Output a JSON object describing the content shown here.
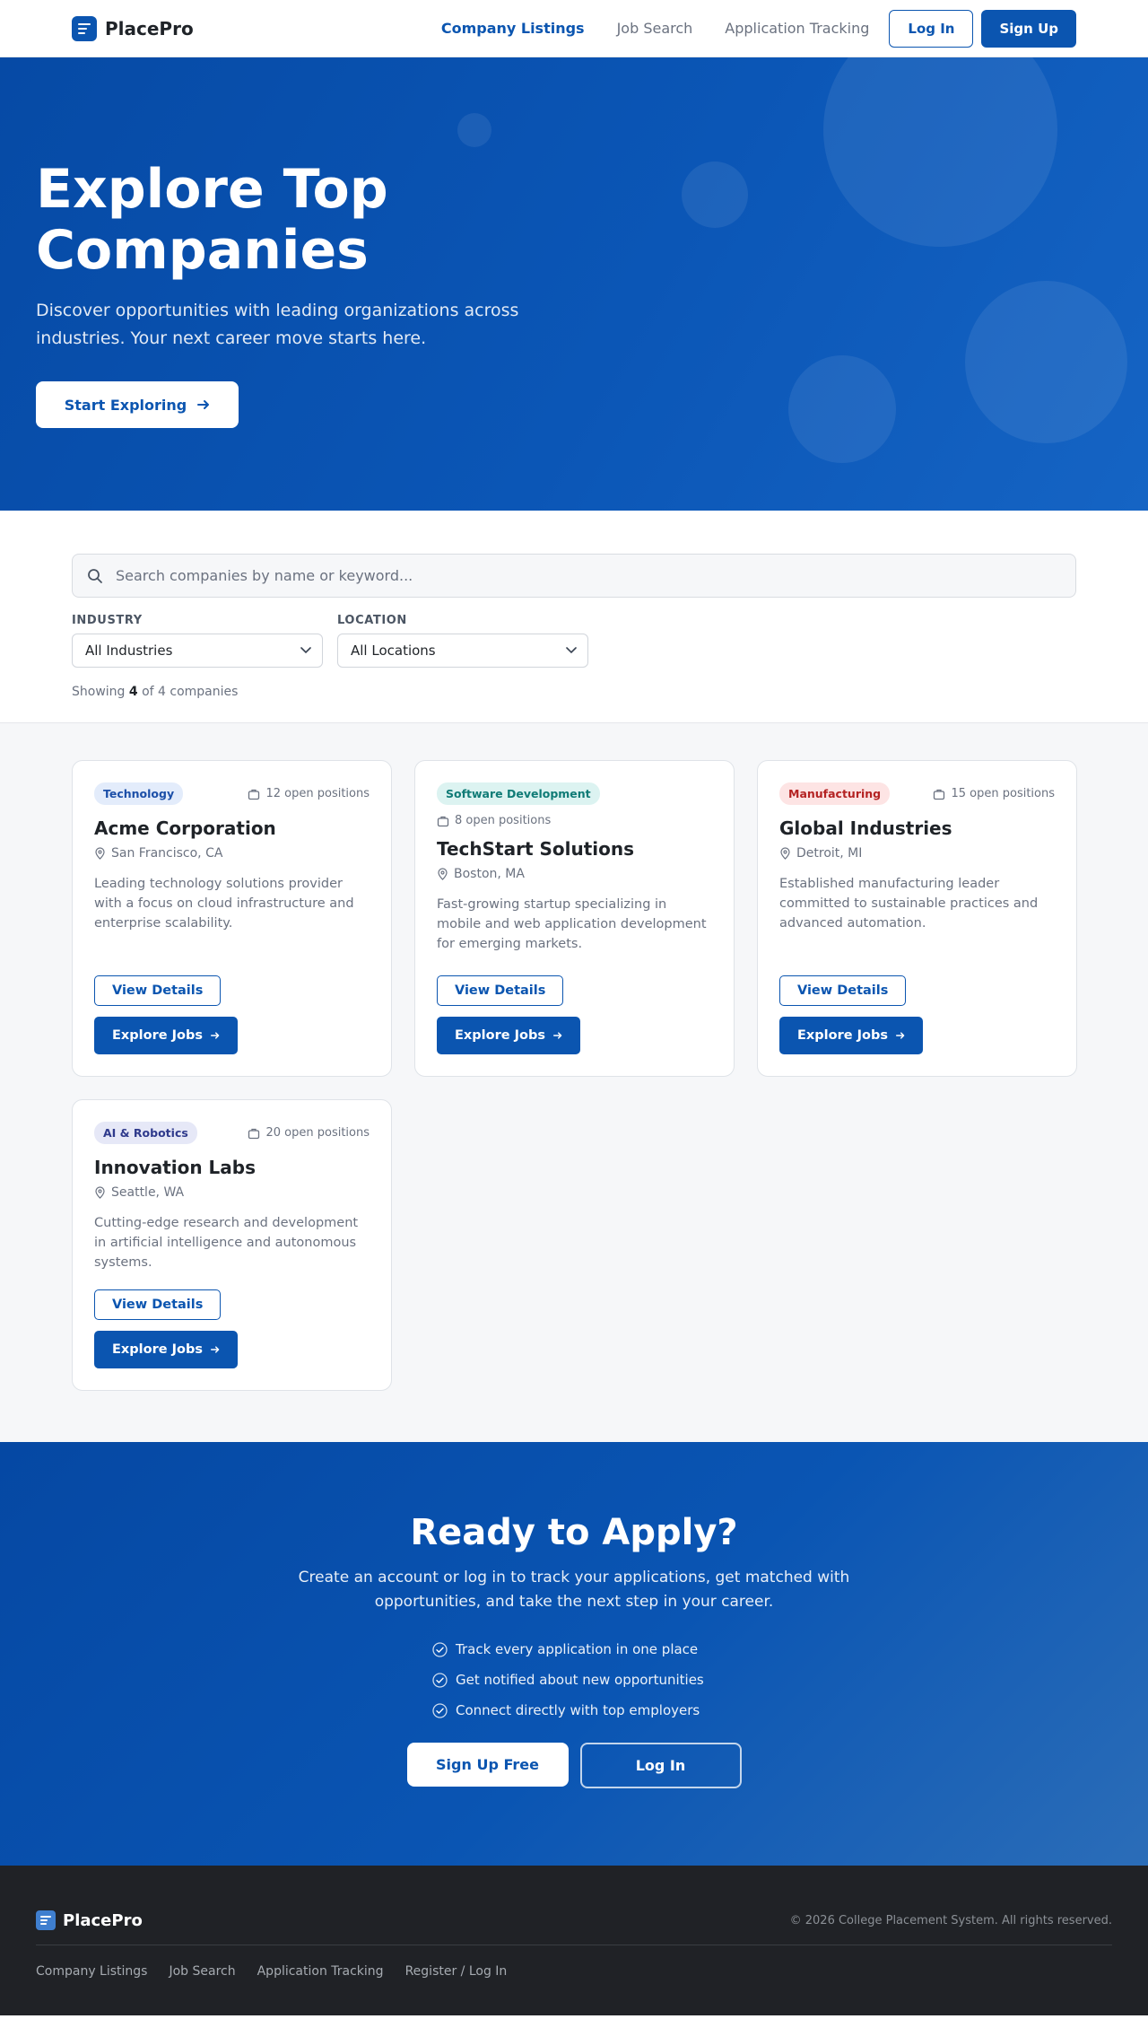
{
  "nav": {
    "brand": "PlacePro",
    "links": [
      "Company Listings",
      "Job Search",
      "Application Tracking"
    ],
    "login": "Log In",
    "signup": "Sign Up"
  },
  "hero": {
    "title_line1": "Explore Top",
    "title_line2": "Companies",
    "subtitle": "Discover opportunities with leading organizations across industries. Your next career move starts here.",
    "button": "Start Exploring"
  },
  "filters": {
    "search_placeholder": "Search companies by name or keyword...",
    "industry_label": "Industry",
    "industry_value": "All Industries",
    "location_label": "Location",
    "location_value": "All Locations",
    "showing_prefix": "Showing",
    "showing_count": "4",
    "showing_suffix": "of 4 companies"
  },
  "companies": [
    {
      "industry": "Technology",
      "positions": "12 open positions",
      "name": "Acme Corporation",
      "location": "San Francisco, CA",
      "description": "Leading technology solutions provider with a focus on cloud infrastructure and enterprise scalability.",
      "details_label": "View Details",
      "jobs_label": "Explore Jobs"
    },
    {
      "industry": "Software Development",
      "positions": "8 open positions",
      "name": "TechStart Solutions",
      "location": "Boston, MA",
      "description": "Fast-growing startup specializing in mobile and web application development for emerging markets.",
      "details_label": "View Details",
      "jobs_label": "Explore Jobs"
    },
    {
      "industry": "Manufacturing",
      "positions": "15 open positions",
      "name": "Global Industries",
      "location": "Detroit, MI",
      "description": "Established manufacturing leader committed to sustainable practices and advanced automation.",
      "details_label": "View Details",
      "jobs_label": "Explore Jobs"
    },
    {
      "industry": "AI & Robotics",
      "positions": "20 open positions",
      "name": "Innovation Labs",
      "location": "Seattle, WA",
      "description": "Cutting-edge research and development in artificial intelligence and autonomous systems.",
      "details_label": "View Details",
      "jobs_label": "Explore Jobs"
    }
  ],
  "badge_colors": {
    "technology": {
      "bg": "#e3ecfb",
      "fg": "#1c4fa8"
    },
    "software": {
      "bg": "#dcf3f1",
      "fg": "#0f7b76"
    },
    "manufacturing": {
      "bg": "#fde4e4",
      "fg": "#b42323"
    },
    "ai": {
      "bg": "#e6e8f7",
      "fg": "#2f3a8c"
    }
  },
  "cta": {
    "title": "Ready to Apply?",
    "subtitle": "Create an account or log in to track your applications, get matched with opportunities, and take the next step in your career.",
    "features": [
      "Track every application in one place",
      "Get notified about new opportunities",
      "Connect directly with top employers"
    ],
    "signup": "Sign Up Free",
    "login": "Log In"
  },
  "footer": {
    "brand": "PlacePro",
    "copyright": "© 2026 College Placement System. All rights reserved.",
    "links": [
      "Company Listings",
      "Job Search",
      "Application Tracking",
      "Register / Log In"
    ]
  },
  "colors": {
    "primary": "#0b55b0",
    "footer_bg": "#202226"
  },
  "icons": {
    "brand": "document-lines-icon",
    "search": "search-icon",
    "chevron": "chevron-down-icon",
    "briefcase": "briefcase-icon",
    "pin": "map-pin-icon",
    "arrow": "arrow-right-icon",
    "check": "check-circle-icon"
  }
}
